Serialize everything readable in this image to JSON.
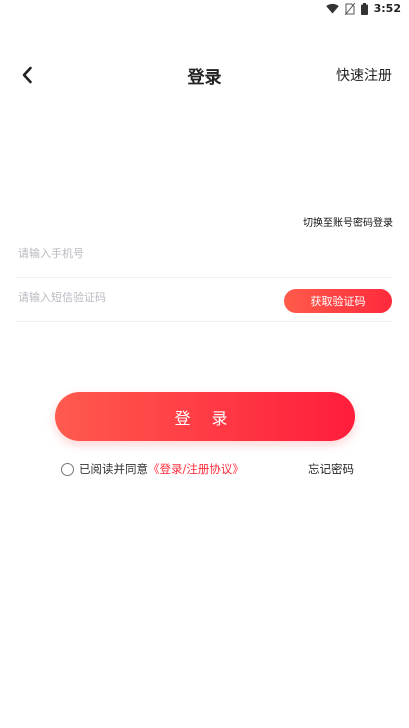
{
  "status_bar": {
    "time": "3:52",
    "icons": [
      "wifi-icon",
      "no-sim-icon",
      "battery-icon"
    ]
  },
  "header": {
    "back_icon": "chevron-left-icon",
    "title": "登录",
    "quick_register": "快速注册"
  },
  "login_form": {
    "switch_mode_link": "切换至账号密码登录",
    "phone_placeholder": "请输入手机号",
    "code_placeholder": "请输入短信验证码",
    "get_code_button": "获取验证码",
    "login_button": "登 录"
  },
  "agreement": {
    "prefix": "已阅读并同意",
    "link": "《登录/注册协议》",
    "checked": false
  },
  "forgot_password": "忘记密码",
  "colors": {
    "accent_start": "#ff5a4e",
    "accent_end": "#ff1d3b",
    "link_red": "#ff2f3d",
    "placeholder": "#b9b9c1"
  }
}
